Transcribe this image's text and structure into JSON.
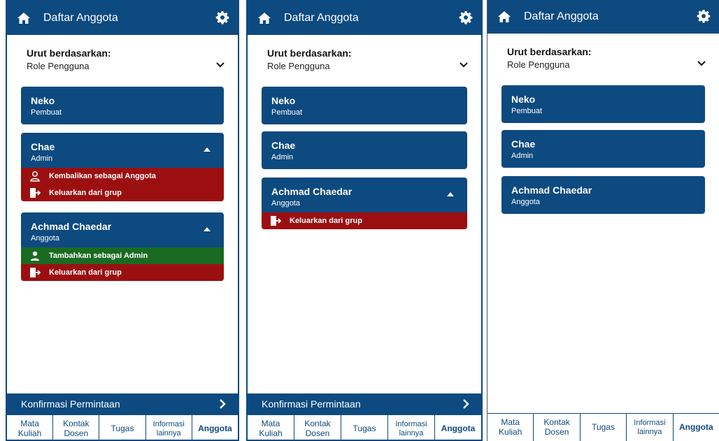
{
  "screens": [
    {
      "header": {
        "title": "Daftar Anggota"
      },
      "sort": {
        "label": "Urut berdasarkan:",
        "value": "Role Pengguna"
      },
      "members": [
        {
          "name": "Neko",
          "role": "Pembuat"
        },
        {
          "name": "Chae",
          "role": "Admin",
          "actions": [
            "Kembalikan sebagai Anggota",
            "Keluarkan dari grup"
          ]
        },
        {
          "name": "Achmad Chaedar",
          "role": "Anggota",
          "actions": [
            "Tambahkan sebagai Admin",
            "Keluarkan dari grup"
          ]
        }
      ],
      "confirm_label": "Konfirmasi Permintaan",
      "tabs": [
        [
          "Mata",
          "Kuliah"
        ],
        [
          "Kontak",
          "Dosen"
        ],
        [
          "Tugas"
        ],
        [
          "Informasi",
          "lainnya"
        ],
        [
          "Anggota"
        ]
      ]
    },
    {
      "header": {
        "title": "Daftar Anggota"
      },
      "sort": {
        "label": "Urut berdasarkan:",
        "value": "Role Pengguna"
      },
      "members": [
        {
          "name": "Neko",
          "role": "Pembuat"
        },
        {
          "name": "Chae",
          "role": "Admin"
        },
        {
          "name": "Achmad Chaedar",
          "role": "Anggota",
          "actions": [
            "Keluarkan dari grup"
          ]
        }
      ],
      "confirm_label": "Konfirmasi Permintaan",
      "tabs": [
        [
          "Mata",
          "Kuliah"
        ],
        [
          "Kontak",
          "Dosen"
        ],
        [
          "Tugas"
        ],
        [
          "Informasi",
          "lainnya"
        ],
        [
          "Anggota"
        ]
      ]
    },
    {
      "header": {
        "title": "Daftar Anggota"
      },
      "sort": {
        "label": "Urut berdasarkan:",
        "value": "Role Pengguna"
      },
      "members": [
        {
          "name": "Neko",
          "role": "Pembuat"
        },
        {
          "name": "Chae",
          "role": "Admin"
        },
        {
          "name": "Achmad Chaedar",
          "role": "Anggota"
        }
      ],
      "tabs": [
        [
          "Mata",
          "Kuliah"
        ],
        [
          "Kontak",
          "Dosen"
        ],
        [
          "Tugas"
        ],
        [
          "Informasi",
          "lainnya"
        ],
        [
          "Anggota"
        ]
      ]
    }
  ],
  "colors": {
    "primary": "#0d4a80",
    "danger": "#9c0f10",
    "success": "#1a6a22"
  },
  "icons": {
    "header_left": "home-icon",
    "header_right": "gear-icon",
    "sort": "chevron-down-icon",
    "expanded": "caret-up-icon",
    "confirm": "chevron-right-icon",
    "demote": "user-outline-icon",
    "promote": "user-solid-icon",
    "remove": "exit-door-icon"
  }
}
